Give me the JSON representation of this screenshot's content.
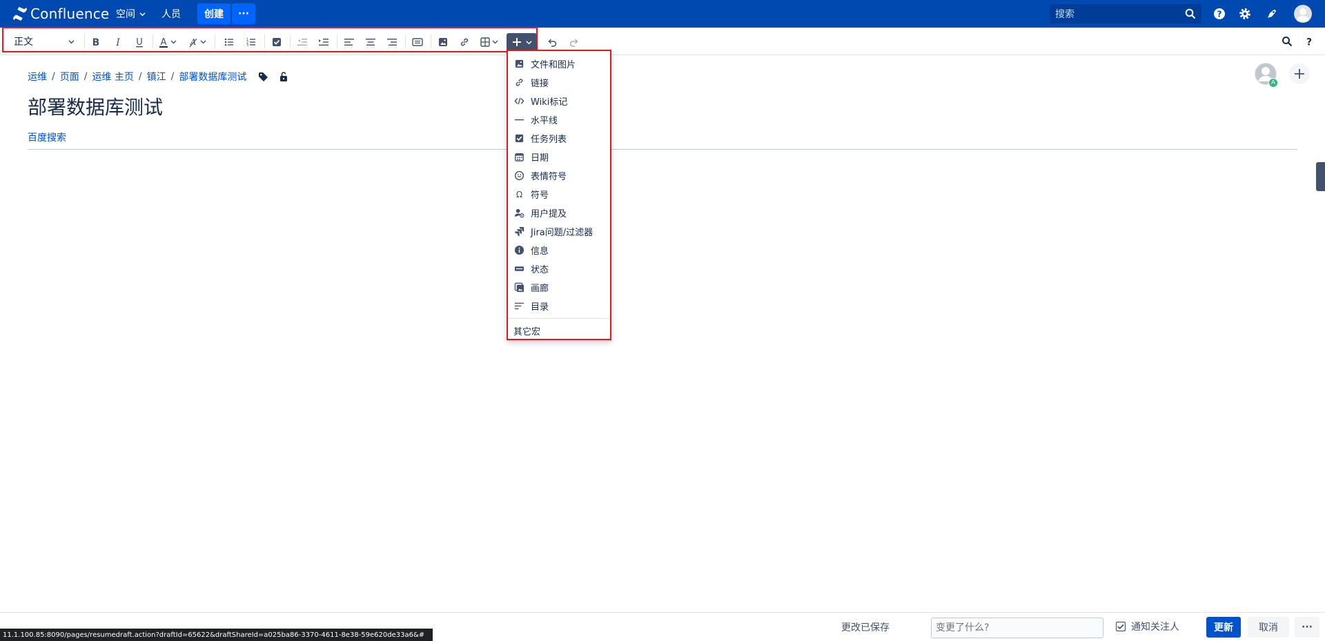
{
  "colors": {
    "nav_bg": "#0049b0",
    "primary": "#0065ff",
    "link": "#0052cc",
    "highlight_outline": "#e8161e",
    "insert_button_bg": "#42526e"
  },
  "topnav": {
    "app_name": "Confluence",
    "spaces_label": "空间",
    "people_label": "人员",
    "create_label": "创建",
    "more_label": "···",
    "search_placeholder": "搜索",
    "icons": [
      "search-icon",
      "help-icon",
      "settings-icon",
      "notifications-icon",
      "user-avatar"
    ]
  },
  "toolbar": {
    "paragraph_style": "正文",
    "buttons": [
      "bold",
      "italic",
      "underline",
      "text-color",
      "clear-formatting",
      "bullet-list",
      "numbered-list",
      "task-list",
      "outdent",
      "indent",
      "align-left",
      "align-center",
      "align-right",
      "page-layout",
      "insert-image",
      "insert-link",
      "insert-table",
      "insert-more",
      "undo",
      "redo"
    ],
    "right_icons": [
      "find-replace",
      "help"
    ]
  },
  "breadcrumb": {
    "items": [
      "运维",
      "页面",
      "运维 主页",
      "镇江",
      "部署数据库测试"
    ]
  },
  "page": {
    "title": "部署数据库测试",
    "body_link": "百度搜索"
  },
  "collaborators": {
    "badge": "A"
  },
  "insert_menu": {
    "items": [
      {
        "label": "文件和图片",
        "icon": "image-icon"
      },
      {
        "label": "链接",
        "icon": "link-icon"
      },
      {
        "label": "Wiki标记",
        "icon": "code-icon"
      },
      {
        "label": "水平线",
        "icon": "horizontal-rule-icon"
      },
      {
        "label": "任务列表",
        "icon": "task-checkbox-icon"
      },
      {
        "label": "日期",
        "icon": "calendar-icon"
      },
      {
        "label": "表情符号",
        "icon": "emoji-icon"
      },
      {
        "label": "符号",
        "icon": "omega-icon"
      },
      {
        "label": "用户提及",
        "icon": "user-mention-icon"
      },
      {
        "label": "Jira问题/过滤器",
        "icon": "jira-icon"
      },
      {
        "label": "信息",
        "icon": "info-icon"
      },
      {
        "label": "状态",
        "icon": "status-lozenge-icon"
      },
      {
        "label": "画廊",
        "icon": "gallery-icon"
      },
      {
        "label": "目录",
        "icon": "toc-icon"
      }
    ],
    "other_macros": "其它宏"
  },
  "footer": {
    "saved_status": "更改已保存",
    "change_placeholder": "变更了什么?",
    "notify_label": "通知关注人",
    "notify_checked": true,
    "update_label": "更新",
    "cancel_label": "取消",
    "more_label": "···",
    "status_url": "11.1.100.85:8090/pages/resumedraft.action?draftId=65622&draftShareId=a025ba86-3370-4611-8e38-59e620de33a6&#"
  }
}
